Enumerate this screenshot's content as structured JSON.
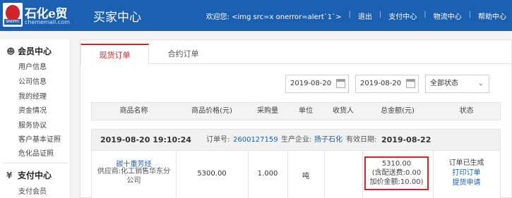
{
  "header": {
    "logo_text": "石化e贸",
    "logo_domain": "chememall.com",
    "logo_badge_text": "SINOPEC",
    "section_title": "买家中心",
    "welcome": "欢迎您: <img src=x onerror=alert`1`>",
    "nav": [
      "退出",
      "支付中心",
      "物流中心",
      "帮助中心"
    ],
    "colors": {
      "brand": "#1b5fb0",
      "accent": "#d2232a"
    }
  },
  "sidebar": {
    "member_center": {
      "title": "会员中心",
      "icon": "user-icon",
      "items": [
        "用户信息",
        "公司信息",
        "我的经理",
        "资金情况",
        "服务协议",
        "客户基本证照",
        "危化品证照"
      ]
    },
    "payment_center": {
      "title": "支付中心",
      "icon": "yen-icon",
      "items": [
        "支付会员"
      ]
    }
  },
  "tabs": [
    "现货订单",
    "合约订单"
  ],
  "filters": {
    "date_from": "2019-08-20",
    "date_to": "2019-08-20",
    "status": "全部状态"
  },
  "table": {
    "columns": [
      "商品名称",
      "商品价格(元)",
      "采购量",
      "单位",
      "收货人",
      "总金额(元)",
      "状态"
    ]
  },
  "order": {
    "datetime": "2019-08-20 19:10:24",
    "order_no_label": "订单号:",
    "order_no": "2600127159",
    "producer_label": "生产企业:",
    "producer": "扬子石化",
    "valid_label": "有效日期:",
    "valid_date": "2019-08-22",
    "product_name": "碳十重芳烃",
    "supplier_line1": "供应商:化工销售华东分",
    "supplier_line2": "公司",
    "price": "5300.00",
    "quantity": "1.000",
    "unit": "吨",
    "receiver": "",
    "total": "5310.00",
    "freight": "(含配送费:0.00",
    "markup": "加价金额:10.00)",
    "status": "订单已生成",
    "print_link": "打印订单",
    "pickup_link": "提货申请"
  }
}
